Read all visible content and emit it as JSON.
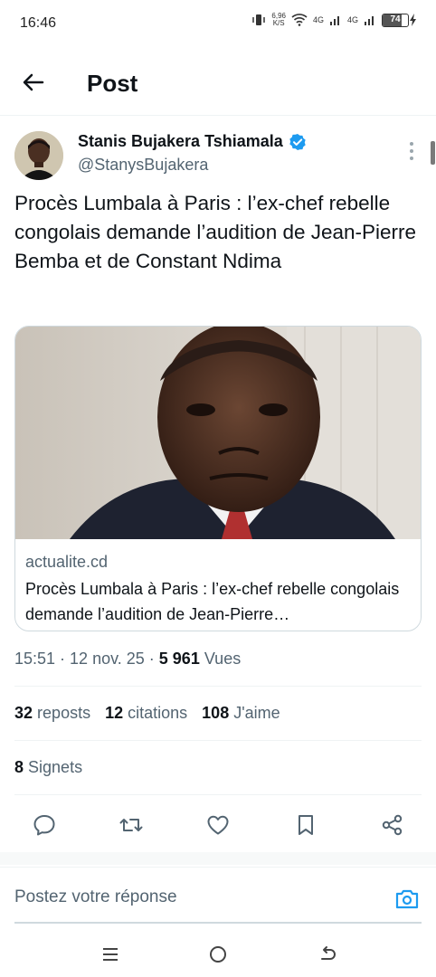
{
  "status_bar": {
    "time": "16:46",
    "network_speed": "6,96",
    "network_unit": "K/S",
    "signal1": "4G",
    "signal2": "4G",
    "battery": "74",
    "battery_level": 0.74
  },
  "header": {
    "title": "Post",
    "back_icon": "arrow-left-icon"
  },
  "author": {
    "name": "Stanis Bujakera Tshiamala",
    "handle": "@StanysBujakera",
    "verified": true
  },
  "tweet": {
    "text": "Procès Lumbala à Paris : l’ex-chef rebelle congolais demande l’audition de Jean-Pierre Bemba et de Constant Ndima"
  },
  "card": {
    "domain": "actualite.cd",
    "title": "Procès Lumbala à Paris : l’ex-chef rebelle congolais demande l’audition de Jean-Pierre…"
  },
  "meta": {
    "time": "15:51",
    "date": "12 nov. 25",
    "views_count": "5 961",
    "views_label": "Vues"
  },
  "stats": {
    "reposts_count": "32",
    "reposts_label": "reposts",
    "quotes_count": "12",
    "quotes_label": "citations",
    "likes_count": "108",
    "likes_label": "J'aime"
  },
  "bookmarks": {
    "count": "8",
    "label": "Signets"
  },
  "actions": [
    "reply-icon",
    "repost-icon",
    "like-icon",
    "bookmark-icon",
    "share-icon"
  ],
  "reply": {
    "placeholder": "Postez votre réponse"
  },
  "colors": {
    "accent": "#1d9bf0",
    "text": "#0f1419",
    "secondary": "#536471",
    "border": "#cfd9de"
  }
}
